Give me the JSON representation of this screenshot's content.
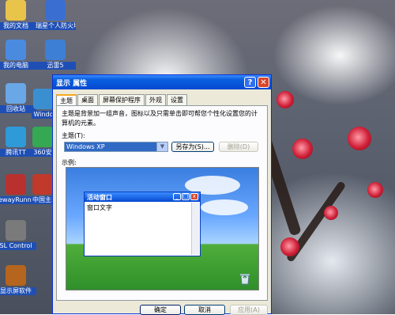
{
  "desktop": {
    "icons": [
      {
        "label": "我的文档",
        "color": "#e8c44a"
      },
      {
        "label": "瑞星个人防火墙",
        "color": "#3a6fd1"
      },
      {
        "label": "我的电脑",
        "color": "#4a8be0"
      },
      {
        "label": "迅雷5",
        "color": "#3d7fd4"
      },
      {
        "label": "回收站",
        "color": "#6aa7e6"
      },
      {
        "label": "Windo",
        "color": "#3a8fd0"
      },
      {
        "label": "腾讯TT",
        "color": "#2f9ad8"
      },
      {
        "label": "360安",
        "color": "#34a853"
      },
      {
        "label": "tewayRunner DSL",
        "color": "#b8312f"
      },
      {
        "label": "中国主动防护",
        "color": "#c0392b"
      },
      {
        "label": "SL Control",
        "color": "#7a7a7a"
      },
      {
        "label": "显示屏软件",
        "color": "#b5651d"
      }
    ]
  },
  "dialog": {
    "title": "显示 属性",
    "help_label": "?",
    "close_label": "✕",
    "tabs": [
      "主题",
      "桌面",
      "屏幕保护程序",
      "外观",
      "设置"
    ],
    "active_tab": 0,
    "description": "主题是背景加一组声音，图标以及只需单击即可帮您个性化设置您的计算机的元素。",
    "theme_label": "主题(T):",
    "theme_value": "Windows XP",
    "save_as_label": "另存为(S)...",
    "delete_label": "删除(D)",
    "example_label": "示例:",
    "preview": {
      "window_title": "活动窗口",
      "window_text": "窗口文字",
      "min_label": "_",
      "max_label": "□",
      "close_label": "x"
    },
    "buttons": {
      "ok": "确定",
      "cancel": "取消",
      "apply": "应用(A)"
    }
  },
  "colors": {
    "accent": "#0549d1",
    "dialog_bg": "#ece9d8"
  }
}
